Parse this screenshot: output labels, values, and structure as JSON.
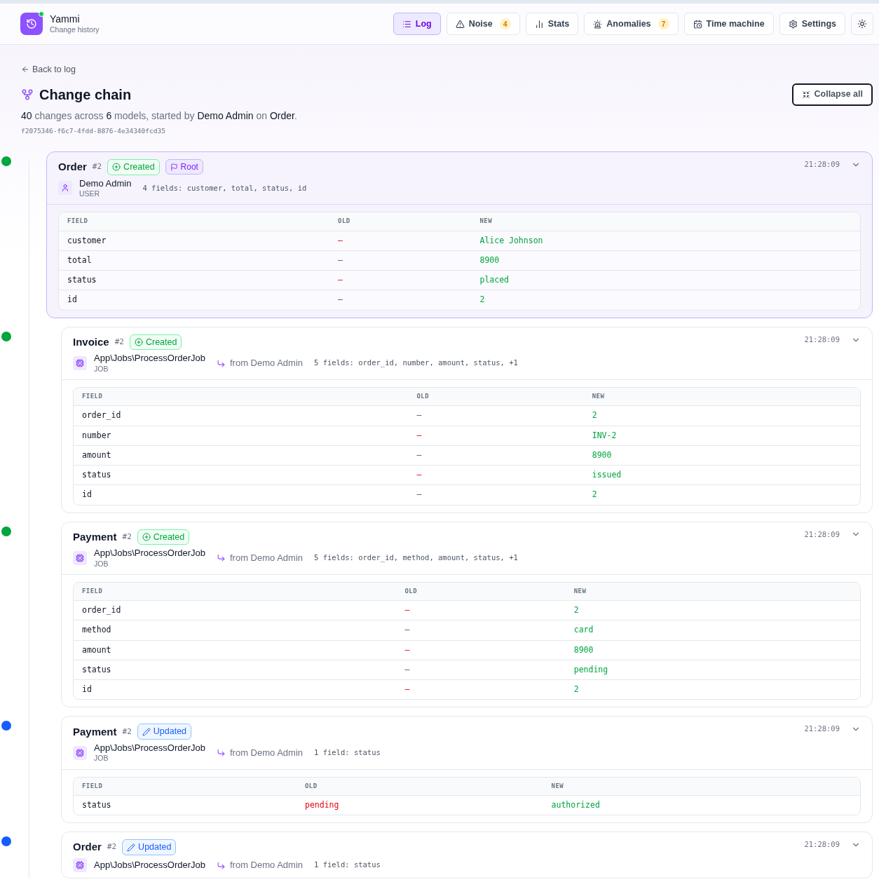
{
  "app": {
    "name": "Yammi",
    "subtitle": "Change history"
  },
  "nav": [
    {
      "label": "Log",
      "selected": true
    },
    {
      "label": "Noise",
      "selected": false,
      "count": "4"
    },
    {
      "label": "Stats",
      "selected": false
    },
    {
      "label": "Anomalies",
      "selected": false,
      "count": "7"
    },
    {
      "label": "Time machine",
      "selected": false
    },
    {
      "label": "Settings",
      "selected": false
    }
  ],
  "back_link": "Back to log",
  "title": "Change chain",
  "collapse_button": "Collapse all",
  "summary": "**40** changes across **6** models, started by **Demo Admin** on **Order**.",
  "chain_id": "f2075346-f6c7-4fdd-8876-4e34340fcd35",
  "chain": {
    "model": "Order",
    "number": "#2",
    "kind": "created",
    "badge": "Created",
    "root_badge": "Root",
    "actor": {
      "kind": "user",
      "name": "Demo Admin",
      "type": "USER"
    },
    "fields_summary": "4 fields: customer, total, status, id",
    "time": "21:28:09",
    "expanded": true,
    "columns": [
      "FIELD",
      "OLD",
      "NEW"
    ],
    "rows": [
      {
        "field": "customer",
        "old": "–",
        "old_highlight": true,
        "new": "Alice Johnson"
      },
      {
        "field": "total",
        "old": "–",
        "old_highlight": false,
        "new": "8900"
      },
      {
        "field": "status",
        "old": "–",
        "old_highlight": true,
        "new": "placed"
      },
      {
        "field": "id",
        "old": "–",
        "old_highlight": false,
        "new": "2"
      }
    ],
    "children": [
      {
        "model": "Invoice",
        "number": "#2",
        "kind": "created",
        "badge": "Created",
        "actor": {
          "kind": "job",
          "name": "App\\Jobs\\ProcessOrderJob",
          "type": "JOB"
        },
        "from": "from Demo Admin",
        "fields_summary": "5 fields: order_id, number, amount, status, +1",
        "time": "21:28:09",
        "expanded": true,
        "columns": [
          "FIELD",
          "OLD",
          "NEW"
        ],
        "rows": [
          {
            "field": "order_id",
            "old": "–",
            "old_highlight": false,
            "new": "2"
          },
          {
            "field": "number",
            "old": "–",
            "old_highlight": true,
            "new": "INV-2"
          },
          {
            "field": "amount",
            "old": "–",
            "old_highlight": false,
            "new": "8900"
          },
          {
            "field": "status",
            "old": "–",
            "old_highlight": true,
            "new": "issued"
          },
          {
            "field": "id",
            "old": "–",
            "old_highlight": false,
            "new": "2"
          }
        ]
      },
      {
        "model": "Payment",
        "number": "#2",
        "kind": "created",
        "badge": "Created",
        "actor": {
          "kind": "job",
          "name": "App\\Jobs\\ProcessOrderJob",
          "type": "JOB"
        },
        "from": "from Demo Admin",
        "fields_summary": "5 fields: order_id, method, amount, status, +1",
        "time": "21:28:09",
        "expanded": true,
        "columns": [
          "FIELD",
          "OLD",
          "NEW"
        ],
        "rows": [
          {
            "field": "order_id",
            "old": "–",
            "old_highlight": true,
            "new": "2"
          },
          {
            "field": "method",
            "old": "–",
            "old_highlight": false,
            "new": "card"
          },
          {
            "field": "amount",
            "old": "–",
            "old_highlight": true,
            "new": "8900"
          },
          {
            "field": "status",
            "old": "–",
            "old_highlight": false,
            "new": "pending"
          },
          {
            "field": "id",
            "old": "–",
            "old_highlight": true,
            "new": "2"
          }
        ]
      },
      {
        "model": "Payment",
        "number": "#2",
        "kind": "updated",
        "badge": "Updated",
        "actor": {
          "kind": "job",
          "name": "App\\Jobs\\ProcessOrderJob",
          "type": "JOB"
        },
        "from": "from Demo Admin",
        "fields_summary": "1 field: status",
        "time": "21:28:09",
        "expanded": true,
        "columns": [
          "FIELD",
          "OLD",
          "NEW"
        ],
        "rows": [
          {
            "field": "status",
            "old": "pending",
            "old_highlight": true,
            "new": "authorized"
          }
        ]
      },
      {
        "model": "Order",
        "number": "#2",
        "kind": "updated",
        "badge": "Updated",
        "actor": {
          "kind": "job",
          "name": "App\\Jobs\\ProcessOrderJob"
        },
        "from": "from Demo Admin",
        "fields_summary": "1 field: status",
        "time": "21:28:09",
        "expanded": true
      }
    ]
  }
}
